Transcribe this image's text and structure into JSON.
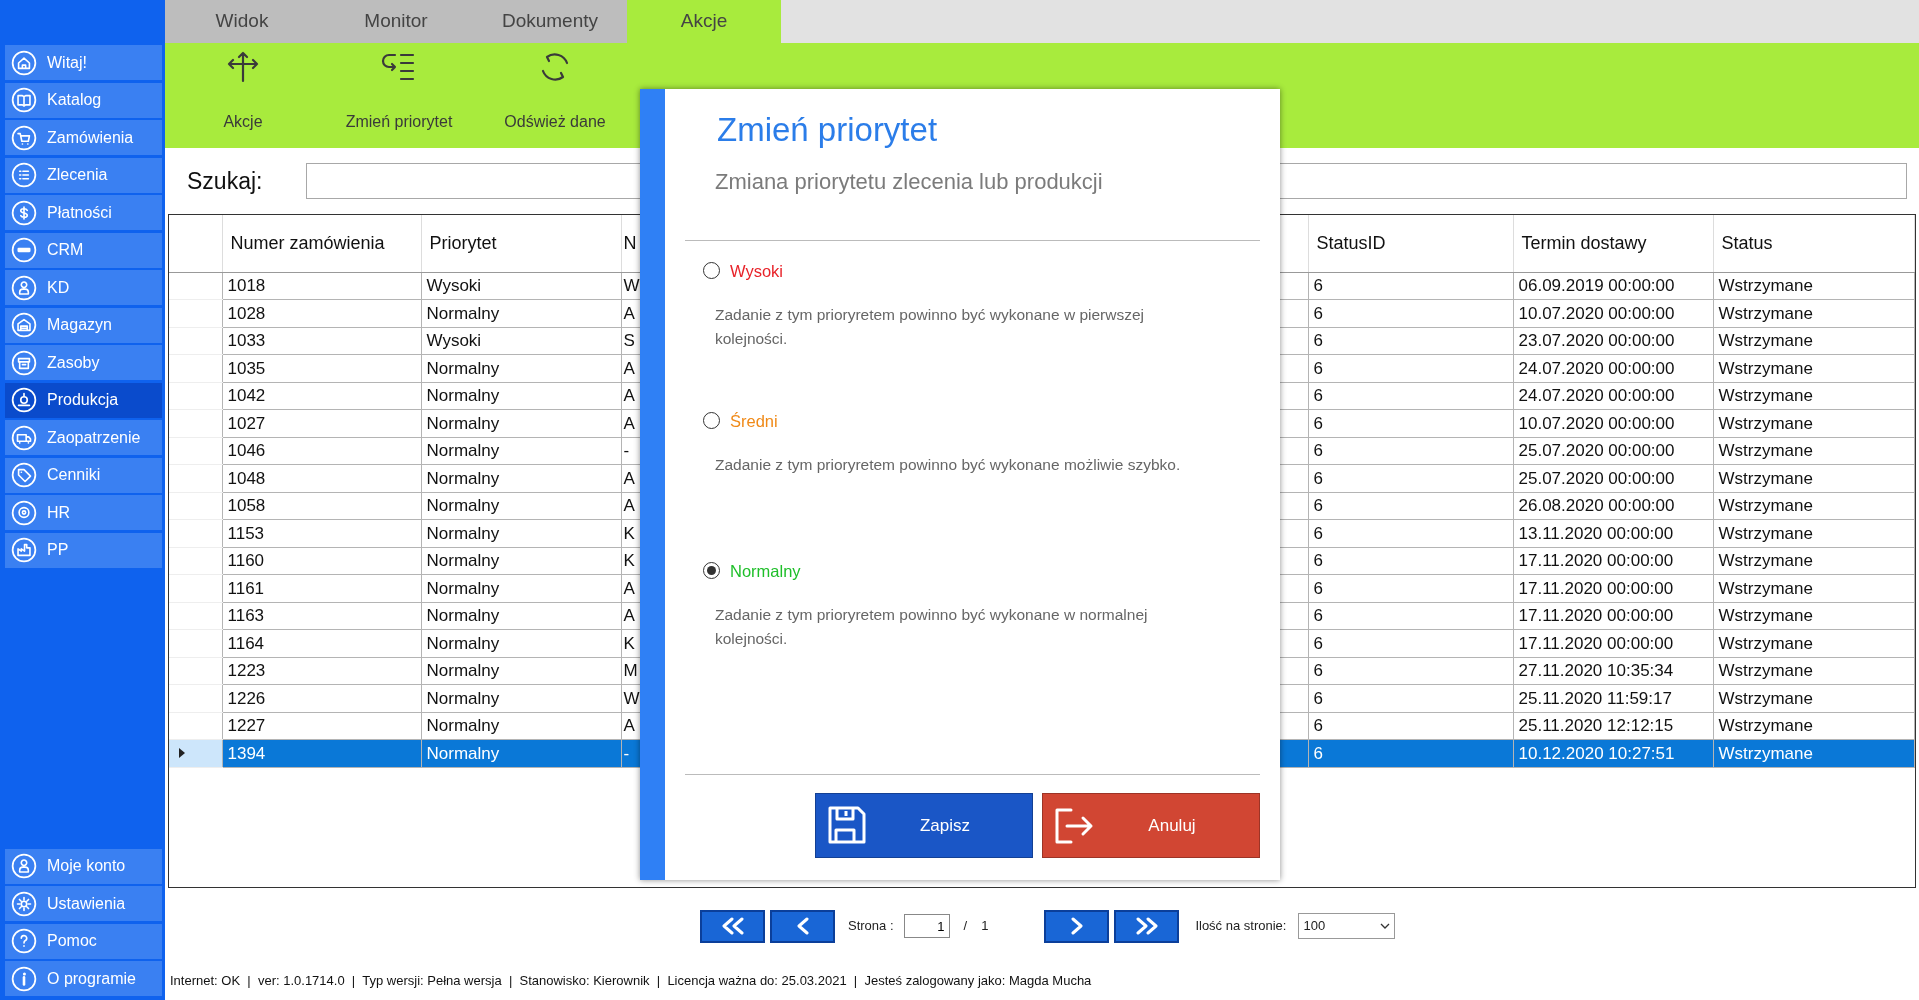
{
  "sidebar": {
    "items": [
      {
        "label": "Witaj!",
        "selected": false
      },
      {
        "label": "Katalog",
        "selected": false
      },
      {
        "label": "Zamówienia",
        "selected": false
      },
      {
        "label": "Zlecenia",
        "selected": false
      },
      {
        "label": "Płatności",
        "selected": false
      },
      {
        "label": "CRM",
        "selected": false
      },
      {
        "label": "KD",
        "selected": false
      },
      {
        "label": "Magazyn",
        "selected": false
      },
      {
        "label": "Zasoby",
        "selected": false
      },
      {
        "label": "Produkcja",
        "selected": true
      },
      {
        "label": "Zaopatrzenie",
        "selected": false
      },
      {
        "label": "Cenniki",
        "selected": false
      },
      {
        "label": "HR",
        "selected": false
      },
      {
        "label": "PP",
        "selected": false
      }
    ],
    "footer_items": [
      {
        "label": "Moje konto"
      },
      {
        "label": "Ustawienia"
      },
      {
        "label": "Pomoc"
      },
      {
        "label": "O programie"
      }
    ]
  },
  "menu_tabs": [
    {
      "label": "Widok",
      "selected": false
    },
    {
      "label": "Monitor",
      "selected": false
    },
    {
      "label": "Dokumenty",
      "selected": false
    },
    {
      "label": "Akcje",
      "selected": true
    }
  ],
  "toolbar": {
    "buttons": [
      {
        "label": "Akcje"
      },
      {
        "label": "Zmień priorytet"
      },
      {
        "label": "Odśwież dane"
      }
    ]
  },
  "search": {
    "label": "Szukaj:"
  },
  "table": {
    "columns": [
      "Numer zamówienia",
      "Priorytet",
      "N",
      "StatusID",
      "Termin dostawy",
      "Status"
    ],
    "rows": [
      {
        "cells": [
          "1018",
          "Wysoki",
          "W",
          "6",
          "06.09.2019 00:00:00",
          "Wstrzymane"
        ],
        "selected": false
      },
      {
        "cells": [
          "1028",
          "Normalny",
          "A",
          "6",
          "10.07.2020 00:00:00",
          "Wstrzymane"
        ],
        "selected": false
      },
      {
        "cells": [
          "1033",
          "Wysoki",
          "S",
          "6",
          "23.07.2020 00:00:00",
          "Wstrzymane"
        ],
        "selected": false
      },
      {
        "cells": [
          "1035",
          "Normalny",
          "A",
          "6",
          "24.07.2020 00:00:00",
          "Wstrzymane"
        ],
        "selected": false
      },
      {
        "cells": [
          "1042",
          "Normalny",
          "A",
          "6",
          "24.07.2020 00:00:00",
          "Wstrzymane"
        ],
        "selected": false
      },
      {
        "cells": [
          "1027",
          "Normalny",
          "A",
          "6",
          "10.07.2020 00:00:00",
          "Wstrzymane"
        ],
        "selected": false
      },
      {
        "cells": [
          "1046",
          "Normalny",
          "-",
          "6",
          "25.07.2020 00:00:00",
          "Wstrzymane"
        ],
        "selected": false
      },
      {
        "cells": [
          "1048",
          "Normalny",
          "A",
          "6",
          "25.07.2020 00:00:00",
          "Wstrzymane"
        ],
        "selected": false
      },
      {
        "cells": [
          "1058",
          "Normalny",
          "A",
          "6",
          "26.08.2020 00:00:00",
          "Wstrzymane"
        ],
        "selected": false
      },
      {
        "cells": [
          "1153",
          "Normalny",
          "K",
          "6",
          "13.11.2020 00:00:00",
          "Wstrzymane"
        ],
        "selected": false
      },
      {
        "cells": [
          "1160",
          "Normalny",
          "K",
          "6",
          "17.11.2020 00:00:00",
          "Wstrzymane"
        ],
        "selected": false
      },
      {
        "cells": [
          "1161",
          "Normalny",
          "A",
          "6",
          "17.11.2020 00:00:00",
          "Wstrzymane"
        ],
        "selected": false
      },
      {
        "cells": [
          "1163",
          "Normalny",
          "A",
          "6",
          "17.11.2020 00:00:00",
          "Wstrzymane"
        ],
        "selected": false
      },
      {
        "cells": [
          "1164",
          "Normalny",
          "K",
          "6",
          "17.11.2020 00:00:00",
          "Wstrzymane"
        ],
        "selected": false
      },
      {
        "cells": [
          "1223",
          "Normalny",
          "M",
          "6",
          "27.11.2020 10:35:34",
          "Wstrzymane"
        ],
        "selected": false
      },
      {
        "cells": [
          "1226",
          "Normalny",
          "W",
          "6",
          "25.11.2020 11:59:17",
          "Wstrzymane"
        ],
        "selected": false
      },
      {
        "cells": [
          "1227",
          "Normalny",
          "A",
          "6",
          "25.11.2020 12:12:15",
          "Wstrzymane"
        ],
        "selected": false
      },
      {
        "cells": [
          "1394",
          "Normalny",
          "-",
          "6",
          "10.12.2020 10:27:51",
          "Wstrzymane"
        ],
        "selected": true
      }
    ]
  },
  "dialog": {
    "title": "Zmień priorytet",
    "subtitle": "Zmiana priorytetu zlecenia lub produkcji",
    "options": [
      {
        "label": "Wysoki",
        "color": "#e8232a",
        "description": "Zadanie z tym prioryretem powinno być wykonane w pierwszej kolejności.",
        "selected": false
      },
      {
        "label": "Średni",
        "color": "#f08a18",
        "description": "Zadanie z tym prioryretem powinno być wykonane możliwie szybko.",
        "selected": false
      },
      {
        "label": "Normalny",
        "color": "#1fbf2a",
        "description": "Zadanie z tym prioryretem powinno być wykonane w normalnej kolejności.",
        "selected": true
      }
    ],
    "buttons": [
      {
        "label": "Zapisz",
        "kind": "save"
      },
      {
        "label": "Anuluj",
        "kind": "cancel"
      }
    ]
  },
  "pagination": {
    "page_label": "Strona :",
    "page": "1",
    "separator": "/",
    "total": "1",
    "per_page_label": "Ilość na stronie:",
    "per_page": "100"
  },
  "status_bar": "Internet: OK  |  ver: 1.0.1714.0  |  Typ wersji: Pełna wersja  |  Stanowisko: Kierownik  |  Licencja ważna do: 25.03.2021  |  Jesteś zalogowany jako: Magda Mucha"
}
